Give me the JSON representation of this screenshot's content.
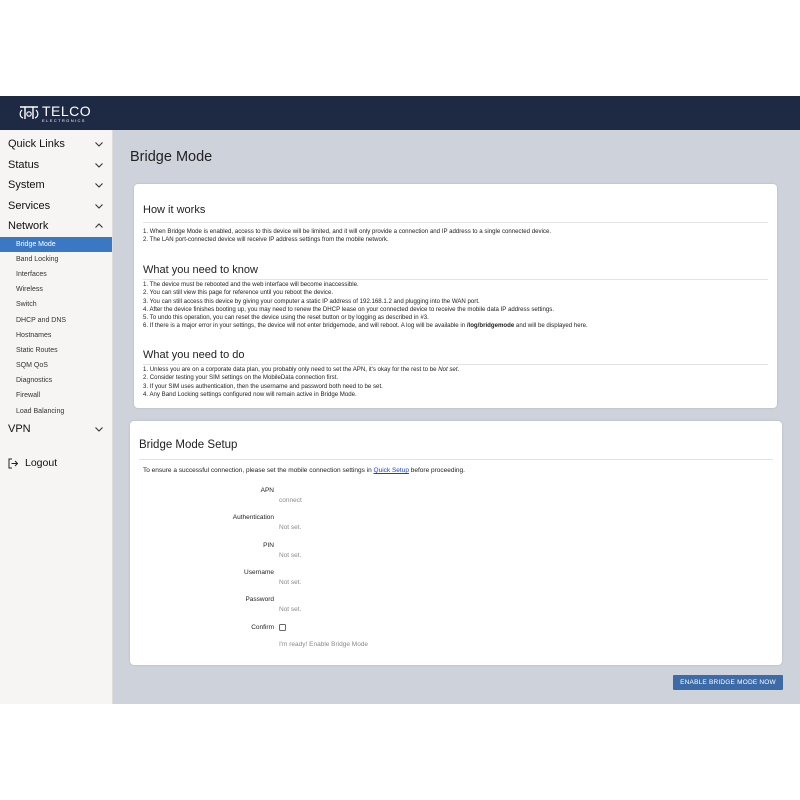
{
  "brand": {
    "name": "TELCO",
    "sub": "ELECTRONICS"
  },
  "sidebar": {
    "sections_top": [
      {
        "label": "Quick Links",
        "icon": "chevron-down-icon"
      },
      {
        "label": "Status",
        "icon": "chevron-down-icon"
      },
      {
        "label": "System",
        "icon": "chevron-down-icon"
      },
      {
        "label": "Services",
        "icon": "chevron-down-icon"
      }
    ],
    "network": {
      "label": "Network",
      "icon": "chevron-up-icon"
    },
    "network_items": [
      "Bridge Mode",
      "Band Locking",
      "Interfaces",
      "Wireless",
      "Switch",
      "DHCP and DNS",
      "Hostnames",
      "Static Routes",
      "SQM QoS",
      "Diagnostics",
      "Firewall",
      "Load Balancing"
    ],
    "active_item": "Bridge Mode",
    "vpn": {
      "label": "VPN",
      "icon": "chevron-down-icon"
    },
    "logout": "Logout"
  },
  "page": {
    "title": "Bridge Mode"
  },
  "how_it_works": {
    "heading": "How it works",
    "lines": [
      "1. When Bridge Mode is enabled, access to this device will be limited, and it will only provide a connection and IP address to a single connected device.",
      "2. The LAN port-connected device will receive IP address settings from the mobile network."
    ]
  },
  "need_to_know": {
    "heading": "What you need to know",
    "lines": [
      "1. The device must be rebooted and the web interface will become inaccessible.",
      "2. You can still view this page for reference until you reboot the device.",
      "3. You can still access this device by giving your computer a static IP address of 192.168.1.2 and plugging into the WAN port.",
      "4. After the device finishes booting up, you may need to renew the DHCP lease on your connected device to receive the mobile data IP address settings.",
      "5. To undo this operation, you can reset the device using the reset button or by logging as described in #3."
    ],
    "line6_pre": "6. If there is a major error in your settings, the device will not enter bridgemode, and will reboot. A log will be available in ",
    "line6_bold": "/log/bridgemode",
    "line6_post": " and will be displayed here."
  },
  "need_to_do": {
    "heading": "What you need to do",
    "line1_pre": "1. Unless you are on a corporate data plan, you probably only need to set the APN, it's okay for the rest to be ",
    "line1_em": "Not set",
    "line1_post": ".",
    "lines": [
      "2. Consider testing your SIM settings on the MobileData connection first.",
      "3. If your SIM uses authentication, then the username and password both need to be set.",
      "4. Any Band Locking settings configured now will remain active in Bridge Mode."
    ]
  },
  "setup": {
    "heading": "Bridge Mode Setup",
    "intro_pre": "To ensure a successful connection, please set the mobile connection settings in ",
    "intro_link": "Quick Setup",
    "intro_post": " before proceeding.",
    "fields": [
      {
        "label": "APN",
        "value": "connect"
      },
      {
        "label": "Authentication",
        "value": "Not set."
      },
      {
        "label": "PIN",
        "value": "Not set."
      },
      {
        "label": "Username",
        "value": "Not set."
      },
      {
        "label": "Password",
        "value": "Not set."
      }
    ],
    "confirm_label": "Confirm",
    "confirm_checked": false,
    "confirm_hint": "I'm ready! Enable Bridge Mode"
  },
  "button": {
    "enable": "ENABLE BRIDGE MODE NOW"
  },
  "colors": {
    "topbar": "#1e2a44",
    "active": "#3b78c4",
    "button": "#3d6ba8",
    "main_bg": "#ced2da",
    "link": "#1a3fd1"
  }
}
